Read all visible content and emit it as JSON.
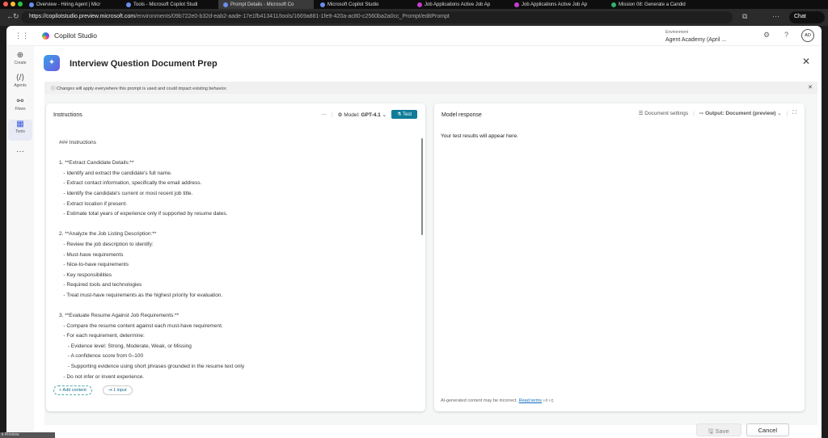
{
  "browser": {
    "tabs": [
      "Overview - Hiring Agent | Micr",
      "Tools - Microsoft Copilot Studi",
      "Prompt Details - Microsoft Co",
      "Microsoft Copilot Studio",
      "Job Applications Active Job Ap",
      "Job Applications Active Job Ap",
      "Mission 08: Generate a Candid"
    ],
    "url_host": "https://copilotstudio.preview.microsoft.com",
    "url_path": "/environments/09b722e0-b32d-eab2-aade-17e1fb413411/tools/1669a881-1fe9-420a-ac80-c2560ba2a0cc_Prompt/editPrompt",
    "chat": "Chat"
  },
  "header": {
    "app": "Copilot Studio",
    "env_label": "Environment",
    "env_name": "Agent Academy (April ...",
    "avatar": "AD"
  },
  "rail": [
    {
      "label": "Create",
      "icon": "⊕"
    },
    {
      "label": "Agents",
      "icon": "⟨/⟩"
    },
    {
      "label": "Flows",
      "icon": "⚯"
    },
    {
      "label": "Tools",
      "icon": "▦"
    },
    {
      "label": "",
      "icon": "···"
    }
  ],
  "page": {
    "title": "Interview Question Document Prep",
    "banner": "Changes will apply everywhere this prompt is used and could impact existing behavior."
  },
  "instructions": {
    "title": "Instructions",
    "more": "···",
    "model_label": "Model:",
    "model": "GPT-4.1",
    "test": "Test",
    "add_content": "+ Add content",
    "input": "1 input",
    "lines": [
      "### Instructions",
      "",
      "1. **Extract Candidate Details:**",
      "   - Identify and extract the candidate's full name.",
      "   - Extract contact information, specifically the email address.",
      "   - Identify the candidate's current or most recent job title.",
      "   - Extract location if present.",
      "   - Estimate total years of experience only if supported by resume dates.",
      "",
      "2. **Analyze the Job Listing Description:**",
      "   - Review the job description to identify:",
      "   - Must-have requirements",
      "   - Nice-to-have requirements",
      "   - Key responsibilities",
      "   - Required tools and technologies",
      "   - Treat must-have requirements as the highest priority for evaluation.",
      "",
      "3. **Evaluate Resume Against Job Requirements:**",
      "   - Compare the resume content against each must-have requirement.",
      "   - For each requirement, determine:",
      "      - Evidence level: Strong, Moderate, Weak, or Missing",
      "      - A confidence score from 0–100",
      "      - Supporting evidence using short phrases grounded in the resume text only",
      "   - Do not infer or invent experience."
    ]
  },
  "response": {
    "title": "Model response",
    "doc_settings": "Document settings",
    "output_label": "Output:",
    "output": "Document (preview)",
    "placeholder": "Your test results will appear here.",
    "disclaimer": "AI-generated content may be incorrect.",
    "read_terms": "Read terms"
  },
  "footer": {
    "save": "Save",
    "cancel": "Cancel"
  },
  "download": "Ⅱ Preview"
}
